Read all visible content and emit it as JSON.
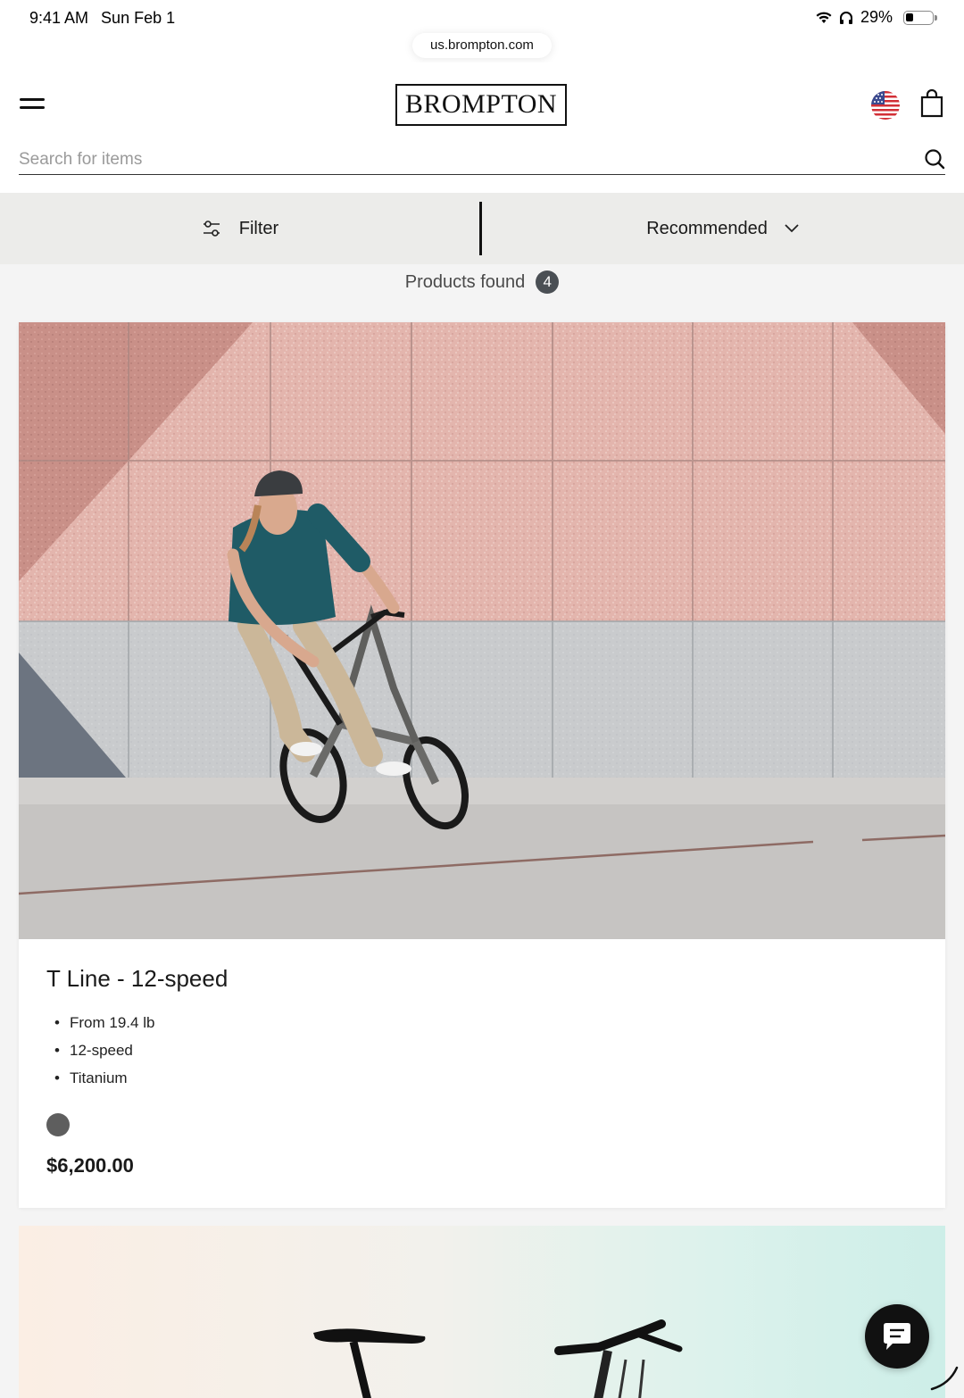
{
  "status_bar": {
    "time": "9:41 AM",
    "date": "Sun Feb 1",
    "battery_text": "29%",
    "battery_level": 0.29
  },
  "browser": {
    "url": "us.brompton.com"
  },
  "header": {
    "logo_text": "BROMPTON",
    "menu_icon": "hamburger-icon",
    "flag_icon": "us-flag-icon",
    "bag_icon": "shopping-bag-icon"
  },
  "search": {
    "placeholder": "Search for items",
    "value": ""
  },
  "toolbar": {
    "filter_label": "Filter",
    "sort_label": "Recommended"
  },
  "results": {
    "label": "Products found",
    "count": "4"
  },
  "products": [
    {
      "title": "T Line - 12-speed",
      "specs": [
        "From 19.4 lb",
        "12-speed",
        "Titanium"
      ],
      "swatch_color": "#5e5e5e",
      "price": "$6,200.00"
    }
  ],
  "colors": {
    "accent": "#111111",
    "filter_bar_bg": "#ececea",
    "page_bg": "#f4f4f4"
  }
}
